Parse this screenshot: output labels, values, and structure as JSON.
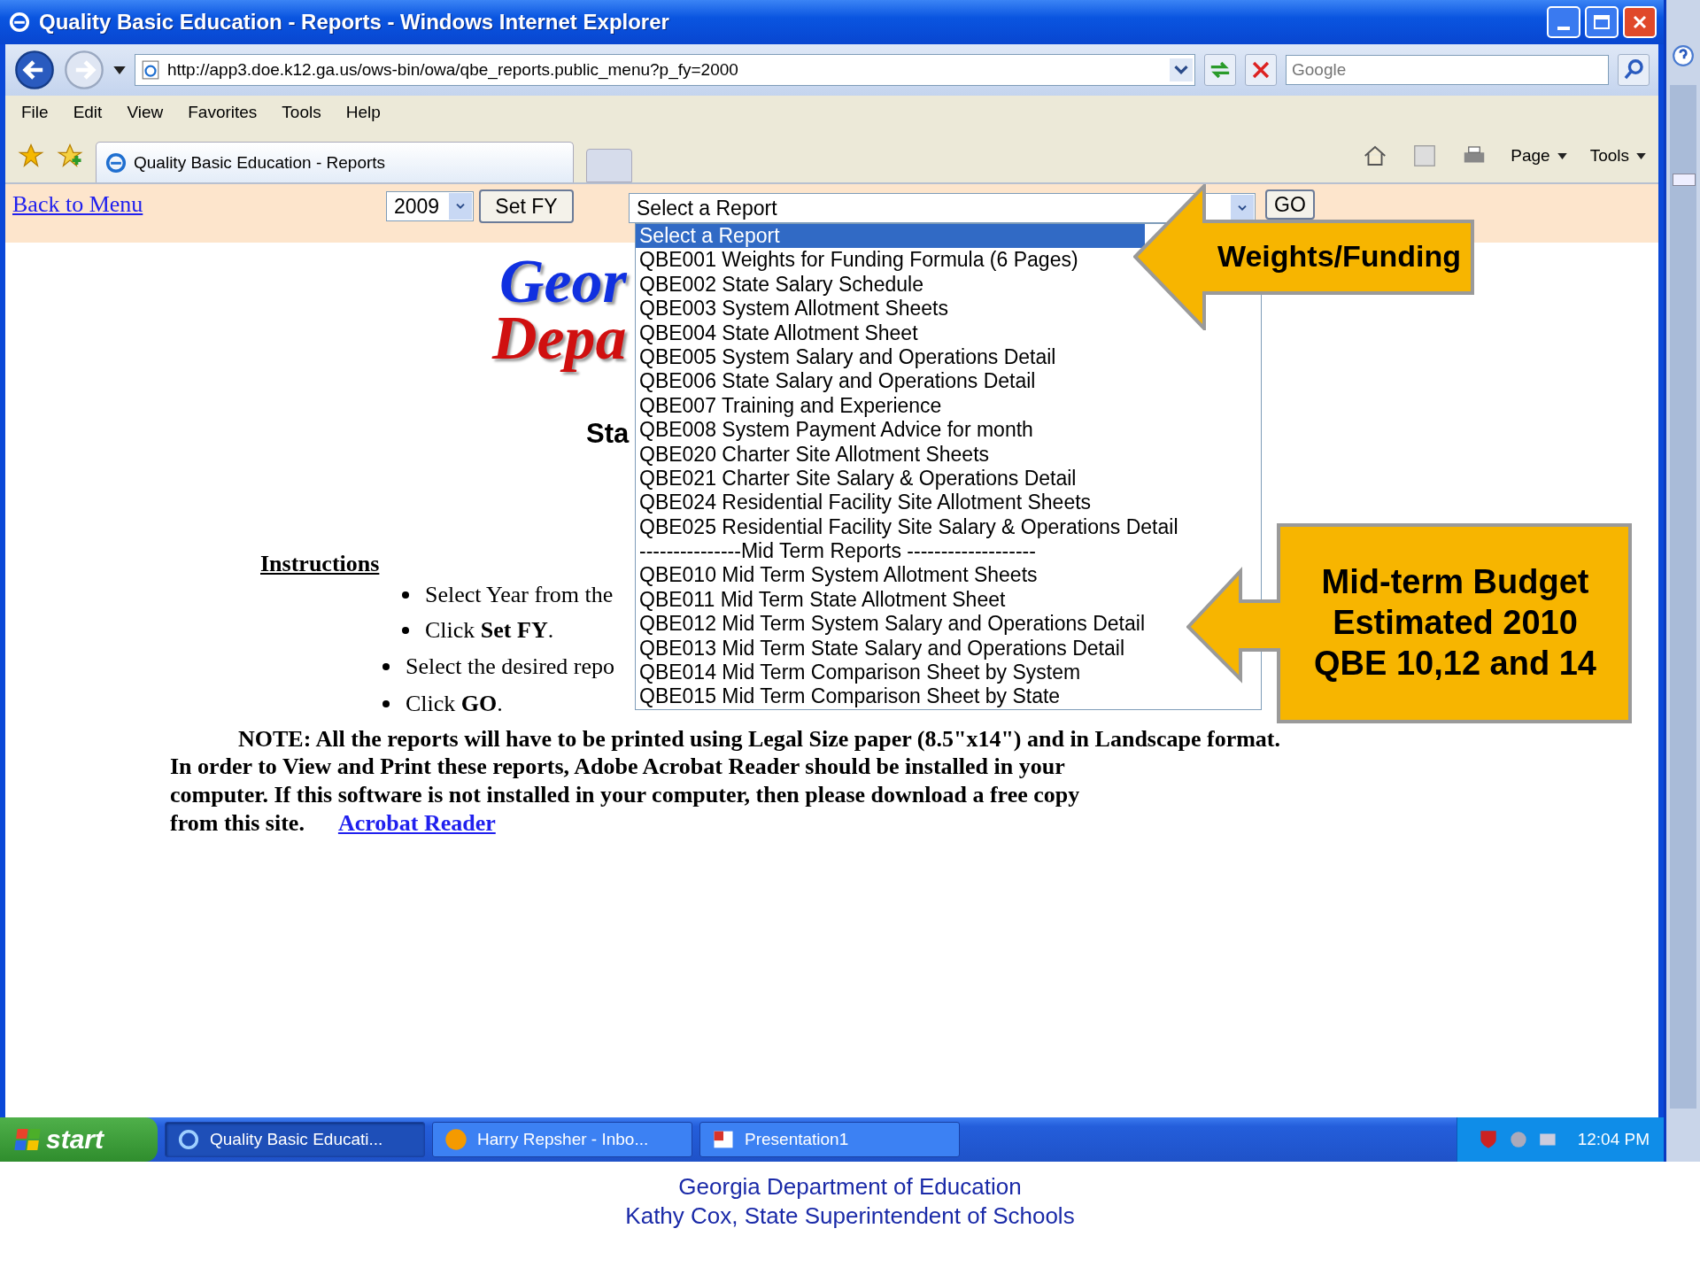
{
  "window": {
    "title": "Quality Basic Education - Reports - Windows Internet Explorer"
  },
  "address_bar": {
    "url": "http://app3.doe.k12.ga.us/ows-bin/owa/qbe_reports.public_menu?p_fy=2000",
    "search_placeholder": "Google"
  },
  "menu": [
    "File",
    "Edit",
    "View",
    "Favorites",
    "Tools",
    "Help"
  ],
  "tabs": [
    {
      "label": "Quality Basic Education - Reports",
      "selected": true
    }
  ],
  "command_bar": [
    "Page",
    "Tools"
  ],
  "page": {
    "back_link": "Back to Menu",
    "year": "2009",
    "set_fy_button": "Set FY",
    "report_select": "Select a Report",
    "go_button": "GO",
    "logo_lines": [
      "Geor",
      "Depa"
    ],
    "heading": "Sta",
    "instructions_title": "Instructions",
    "steps_year": [
      "Select Year from the",
      "Click **Set FY**."
    ],
    "steps_report": [
      "Select the desired repo",
      "Click **GO**."
    ],
    "note": "NOTE: All the reports will have to be printed using Legal Size paper (8.5\"x14\") and in Landscape format.",
    "reader_lines": [
      "In order to View and Print these reports, Adobe Acrobat Reader should be installed in your",
      "computer. If this software is not installed in your computer, then please download a free copy",
      "from this site."
    ],
    "reader_link": "Acrobat Reader"
  },
  "dropdown": {
    "options": [
      {
        "label": "Select a Report",
        "selected": true
      },
      {
        "label": "QBE001 Weights for Funding Formula (6 Pages)",
        "selected": false
      },
      {
        "label": "QBE002 State Salary Schedule",
        "selected": false
      },
      {
        "label": "QBE003 System Allotment Sheets",
        "selected": false
      },
      {
        "label": "QBE004 State Allotment Sheet",
        "selected": false
      },
      {
        "label": "QBE005 System Salary and Operations Detail",
        "selected": false
      },
      {
        "label": "QBE006 State Salary and Operations Detail",
        "selected": false
      },
      {
        "label": "QBE007 Training and Experience",
        "selected": false
      },
      {
        "label": "QBE008 System Payment Advice for month",
        "selected": false
      },
      {
        "label": "QBE020 Charter Site Allotment Sheets",
        "selected": false
      },
      {
        "label": "QBE021 Charter Site Salary & Operations Detail",
        "selected": false
      },
      {
        "label": "QBE024 Residential Facility Site Allotment Sheets",
        "selected": false
      },
      {
        "label": "QBE025 Residential Facility Site Salary & Operations Detail",
        "selected": false
      },
      {
        "label": "---------------Mid Term Reports -------------------",
        "selected": false
      },
      {
        "label": "QBE010 Mid Term System Allotment Sheets",
        "selected": false
      },
      {
        "label": "QBE011 Mid Term State Allotment Sheet",
        "selected": false
      },
      {
        "label": "QBE012 Mid Term System Salary and Operations Detail",
        "selected": false
      },
      {
        "label": "QBE013 Mid Term State Salary and Operations Detail",
        "selected": false
      },
      {
        "label": "QBE014 Mid Term Comparison Sheet by System",
        "selected": false
      },
      {
        "label": "QBE015 Mid Term Comparison Sheet by State",
        "selected": false
      }
    ]
  },
  "callouts": [
    {
      "lines": [
        "Weights/Funding"
      ]
    },
    {
      "lines": [
        "Mid-term Budget",
        "Estimated 2010",
        "QBE 10,12 and 14"
      ]
    }
  ],
  "taskbar": {
    "start": "start",
    "buttons": [
      {
        "label": "Quality Basic Educati...",
        "kind": "browser",
        "selected": true
      },
      {
        "label": "Harry Repsher - Inbo...",
        "kind": "mail",
        "selected": false
      },
      {
        "label": "Presentation1",
        "kind": "slides",
        "selected": false
      }
    ],
    "clock": "12:04 PM"
  },
  "footer": [
    "Georgia Department of Education",
    "Kathy Cox, State Superintendent of Schools"
  ]
}
